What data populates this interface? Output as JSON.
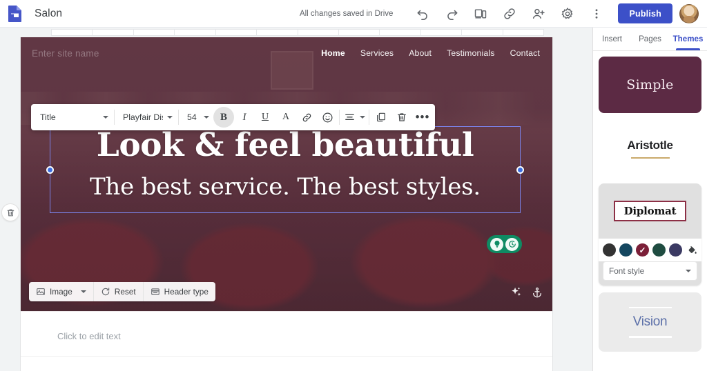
{
  "topbar": {
    "app_icon": "google-sites-icon",
    "doc_title": "Salon",
    "save_status": "All changes saved in Drive",
    "icons": [
      {
        "name": "undo-icon",
        "label": "Undo"
      },
      {
        "name": "redo-icon",
        "label": "Redo"
      },
      {
        "name": "preview-icon",
        "label": "Preview"
      },
      {
        "name": "copy-link-icon",
        "label": "Copy published site link"
      },
      {
        "name": "add-editor-icon",
        "label": "Add editors"
      },
      {
        "name": "settings-gear-icon",
        "label": "Settings"
      },
      {
        "name": "more-options-icon",
        "label": "More"
      }
    ],
    "publish_label": "Publish",
    "avatar": "user-avatar"
  },
  "format_toolbar": {
    "style": "Title",
    "font": "Playfair Disp",
    "size": "54",
    "bold_label": "B",
    "italic_label": "I",
    "underline_label": "U",
    "text_color_label": "A",
    "buttons": [
      {
        "name": "bold-button",
        "active": true
      },
      {
        "name": "italic-button",
        "active": false
      },
      {
        "name": "underline-button",
        "active": false
      },
      {
        "name": "text-color-button",
        "active": false
      },
      {
        "name": "insert-link-button",
        "active": false
      },
      {
        "name": "emoji-button",
        "active": false
      },
      {
        "name": "align-button",
        "active": false
      },
      {
        "name": "duplicate-button",
        "active": false
      },
      {
        "name": "delete-button",
        "active": false
      },
      {
        "name": "more-format-button",
        "active": false
      }
    ]
  },
  "site": {
    "site_name_placeholder": "Enter site name",
    "nav": [
      {
        "label": "Home",
        "active": true
      },
      {
        "label": "Services",
        "active": false
      },
      {
        "label": "About",
        "active": false
      },
      {
        "label": "Testimonials",
        "active": false
      },
      {
        "label": "Contact",
        "active": false
      }
    ],
    "hero": {
      "title": "Look & feel beautiful",
      "subtitle": "The best service. The best styles.",
      "tools": [
        {
          "name": "image-button",
          "label": "Image",
          "icon": "image-icon",
          "has_caret": true
        },
        {
          "name": "reset-button",
          "label": "Reset",
          "icon": "reset-icon",
          "has_caret": false
        },
        {
          "name": "header-type-button",
          "label": "Header type",
          "icon": "header-type-icon",
          "has_caret": false
        }
      ],
      "right_icons": [
        {
          "name": "sparkle-icon"
        },
        {
          "name": "anchor-icon"
        }
      ],
      "assist_pill": [
        "lightbulb-icon",
        "history-icon"
      ]
    },
    "body_placeholder": "Click to edit text"
  },
  "gutter": {
    "delete_section": "delete-section-icon"
  },
  "right_panel": {
    "tabs": [
      {
        "label": "Insert",
        "active": false
      },
      {
        "label": "Pages",
        "active": false
      },
      {
        "label": "Themes",
        "active": true
      }
    ],
    "themes": [
      {
        "name": "Simple",
        "selected": false
      },
      {
        "name": "Aristotle",
        "selected": false
      },
      {
        "name": "Diplomat",
        "selected": true
      },
      {
        "name": "Vision",
        "selected": false
      }
    ],
    "diplomat_colors": [
      {
        "hex": "#333333",
        "selected": false
      },
      {
        "hex": "#14465f",
        "selected": false
      },
      {
        "hex": "#7b1f38",
        "selected": true
      },
      {
        "hex": "#1f4c41",
        "selected": false
      },
      {
        "hex": "#3b3a63",
        "selected": false
      }
    ],
    "custom_color_icon": "paint-bucket-icon",
    "font_style_label": "Font style",
    "check_glyph": "✓"
  },
  "colors": {
    "accent_blue": "#3c50c8",
    "theme_maroon": "#5c2a44",
    "selection_blue": "#7b83eb",
    "assist_green": "#0f8b63"
  }
}
